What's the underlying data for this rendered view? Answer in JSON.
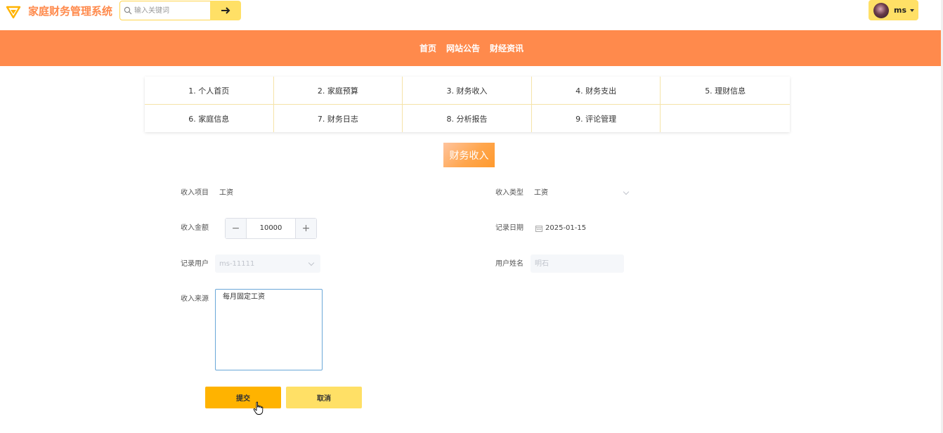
{
  "app": {
    "title": "家庭财务管理系统"
  },
  "search": {
    "placeholder": "输入关键词"
  },
  "user": {
    "name": "ms"
  },
  "nav": [
    "首页",
    "网站公告",
    "财经资讯"
  ],
  "menu": [
    "1. 个人首页",
    "2. 家庭预算",
    "3. 财务收入",
    "4. 财务支出",
    "5. 理财信息",
    "6. 家庭信息",
    "7. 财务日志",
    "8. 分析报告",
    "9. 评论管理",
    ""
  ],
  "section_title": "财务收入",
  "form": {
    "income_item": {
      "label": "收入项目",
      "value": "工资"
    },
    "income_type": {
      "label": "收入类型",
      "value": "工资"
    },
    "amount": {
      "label": "收入金额",
      "value": "10000",
      "minus": "−",
      "plus": "+"
    },
    "record_date": {
      "label": "记录日期",
      "value": "2025-01-15"
    },
    "record_user": {
      "label": "记录用户",
      "value": "ms-11111"
    },
    "user_name": {
      "label": "用户姓名",
      "value": "明石"
    },
    "income_source": {
      "label": "收入来源",
      "value": "每月固定工资"
    }
  },
  "buttons": {
    "submit": "提交",
    "cancel": "取消"
  },
  "colors": {
    "brand_orange": "#ff8a4c",
    "accent_yellow": "#ffe066",
    "submit_yellow": "#ffb300"
  }
}
